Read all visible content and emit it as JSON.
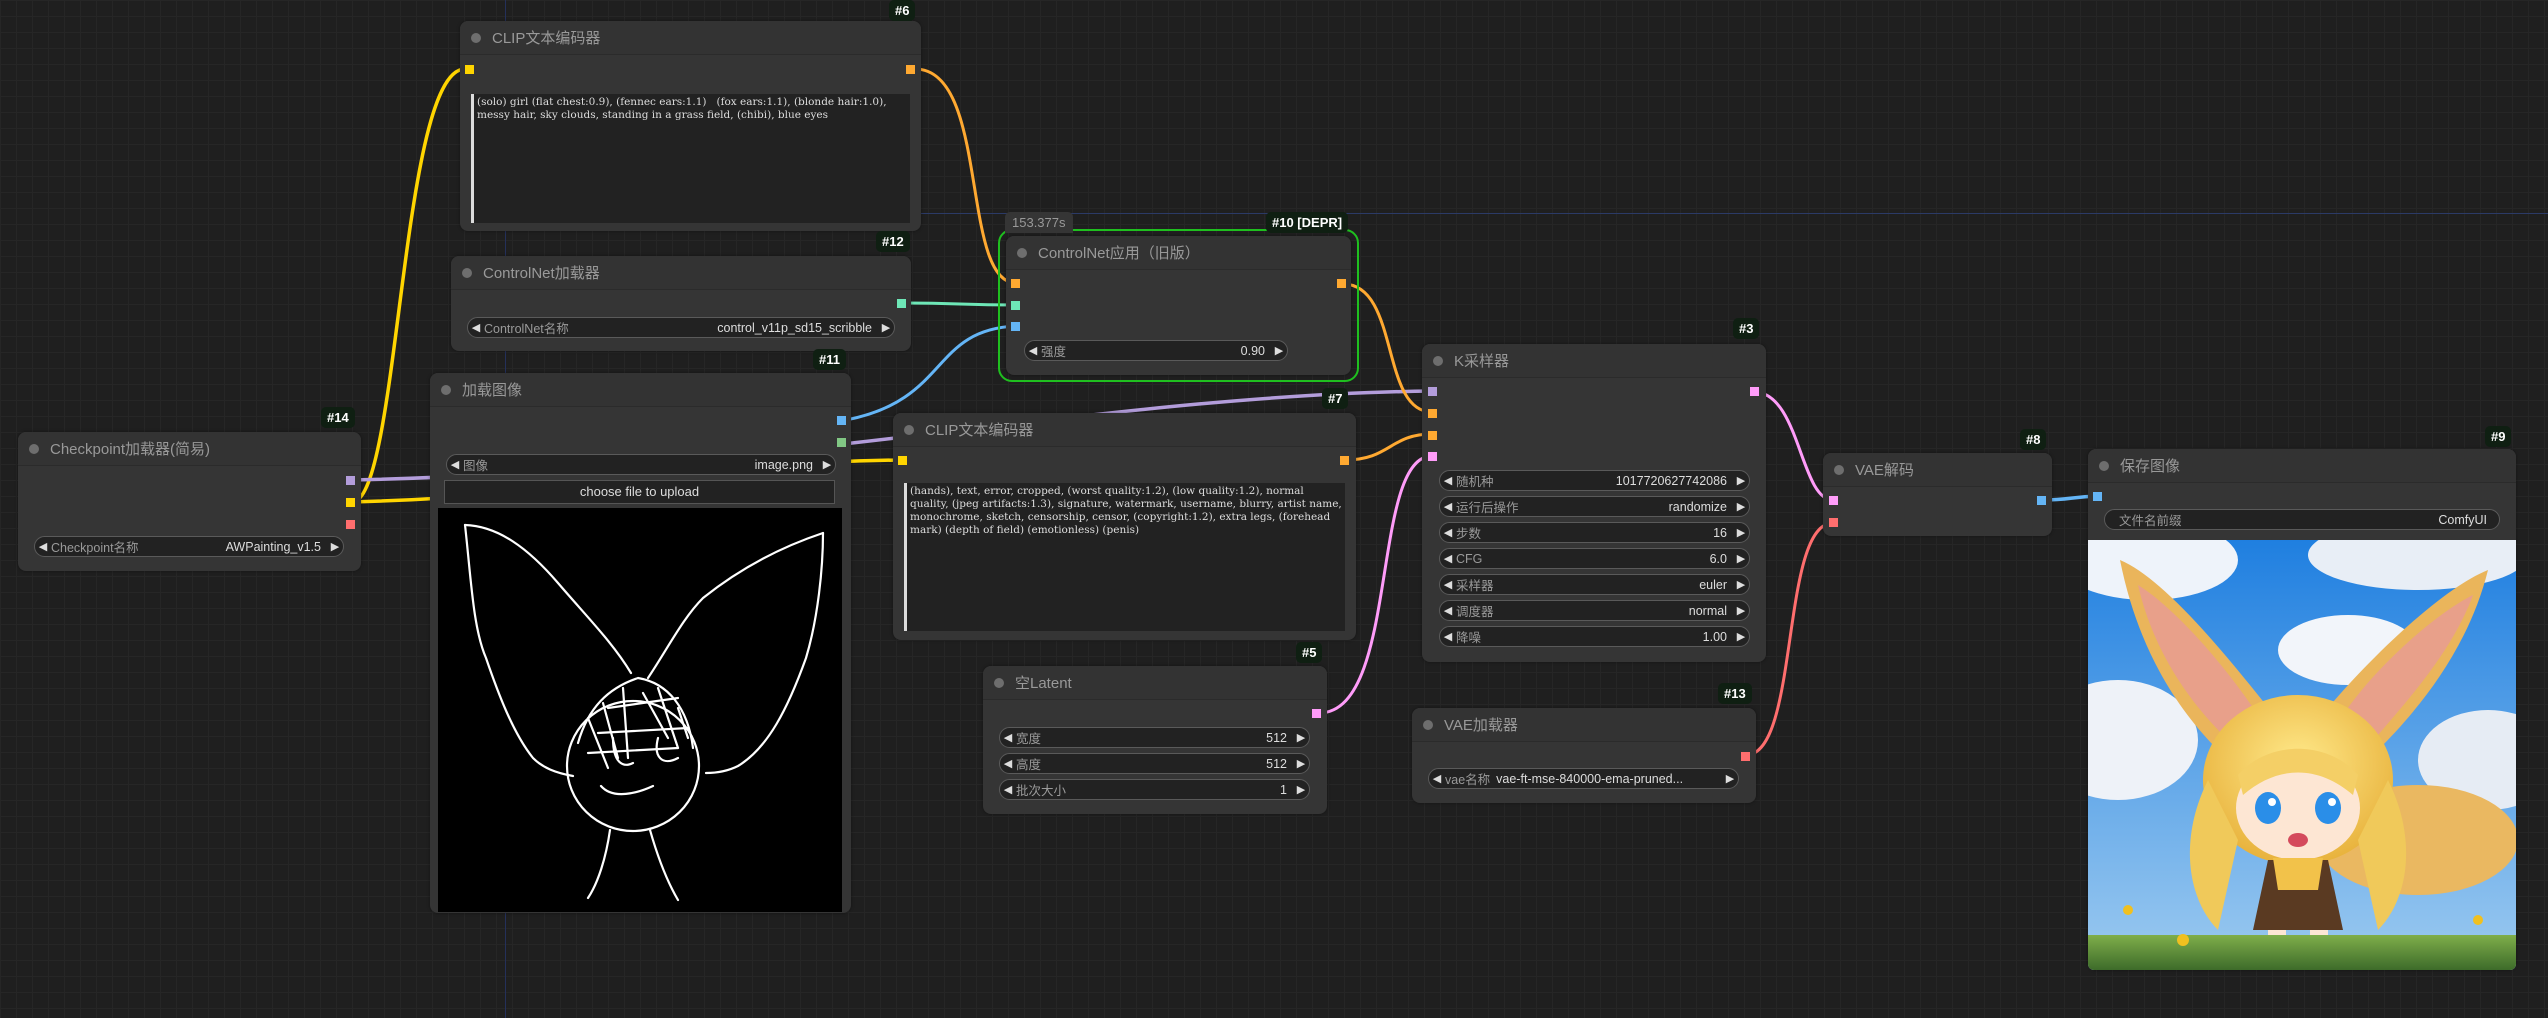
{
  "app": "ComfyUI",
  "nodes": {
    "clip_pos": {
      "id": "#6",
      "title": "CLIP文本编码器",
      "text": "(solo) girl (flat chest:0.9), (fennec ears:1.1)   (fox ears:1.1), (blonde hair:1.0), messy hair, sky clouds, standing in a grass field, (chibi), blue eyes"
    },
    "controlnet_loader": {
      "id": "#12",
      "title": "ControlNet加载器",
      "widgets": [
        {
          "label": "ControlNet名称",
          "value": "control_v11p_sd15_scribble"
        }
      ]
    },
    "load_image": {
      "id": "#11",
      "title": "加载图像",
      "widgets": [
        {
          "label": "图像",
          "value": "image.png"
        }
      ],
      "upload_label": "choose file to upload",
      "preview": "scribble-sketch"
    },
    "checkpoint": {
      "id": "#14",
      "title": "Checkpoint加载器(简易)",
      "widgets": [
        {
          "label": "Checkpoint名称",
          "value": "AWPainting_v1.5"
        }
      ]
    },
    "controlnet_apply": {
      "id": "#10 [DEPR]",
      "title": "ControlNet应用（旧版）",
      "timer": "153.377s",
      "widgets": [
        {
          "label": "强度",
          "value": "0.90"
        }
      ]
    },
    "clip_neg": {
      "id": "#7",
      "title": "CLIP文本编码器",
      "text": "(hands), text, error, cropped, (worst quality:1.2), (low quality:1.2), normal quality, (jpeg artifacts:1.3), signature, watermark, username, blurry, artist name, monochrome, sketch, censorship, censor, (copyright:1.2), extra legs, (forehead mark) (depth of field) (emotionless) (penis)"
    },
    "ksampler": {
      "id": "#3",
      "title": "K采样器",
      "widgets": [
        {
          "label": "随机种",
          "value": "1017720627742086"
        },
        {
          "label": "运行后操作",
          "value": "randomize"
        },
        {
          "label": "步数",
          "value": "16"
        },
        {
          "label": "CFG",
          "value": "6.0"
        },
        {
          "label": "采样器",
          "value": "euler"
        },
        {
          "label": "调度器",
          "value": "normal"
        },
        {
          "label": "降噪",
          "value": "1.00"
        }
      ]
    },
    "empty_latent": {
      "id": "#5",
      "title": "空Latent",
      "widgets": [
        {
          "label": "宽度",
          "value": "512"
        },
        {
          "label": "高度",
          "value": "512"
        },
        {
          "label": "批次大小",
          "value": "1"
        }
      ]
    },
    "vae_loader": {
      "id": "#13",
      "title": "VAE加载器",
      "widgets": [
        {
          "label": "vae名称",
          "value": "vae-ft-mse-840000-ema-pruned..."
        }
      ]
    },
    "vae_decode": {
      "id": "#8",
      "title": "VAE解码"
    },
    "save_image": {
      "id": "#9",
      "title": "保存图像",
      "widgets": [
        {
          "label": "文件名前缀",
          "value": "ComfyUI"
        }
      ],
      "preview": "chibi-fennec-girl-image"
    }
  },
  "slot_colors": {
    "model": "#b39ddb",
    "clip": "#ffd500",
    "vae": "#ff6e6e",
    "conditioning": "#ffa931",
    "control_net": "#6ee7b7",
    "image": "#64b5f6",
    "mask": "#81c784",
    "latent": "#ff9cf9"
  },
  "arrow_left": "◀",
  "arrow_right": "▶"
}
